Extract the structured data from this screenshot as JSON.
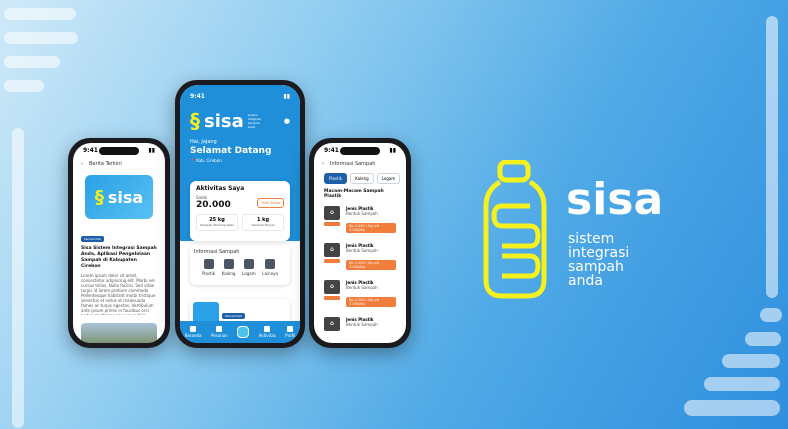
{
  "colors": {
    "brand_blue": "#1e8fd8",
    "accent_yellow": "#f4f11f",
    "accent_orange": "#f07d3a",
    "white": "#ffffff"
  },
  "brand": {
    "word": "sisa",
    "tagline": [
      "sistem",
      "integrasi",
      "sampah",
      "anda"
    ]
  },
  "left_phone": {
    "time": "9:41",
    "title": "Berita Terkini",
    "card_word": "sisa",
    "tag": "Pemerintah",
    "headline": "Sisa Sistem Integrasi Sampah Anda, Aplikasi Pengelolaan Sampah di Kabupaten Cirebon",
    "body": "Lorem ipsum dolor sit amet, consectetur adipiscing elit. Morbi vel cursus tellus. Nulla facilisi. Sed vitae turpis id lorem pretium commodo. Pellentesque habitant morbi tristique senectus et netus et malesuada fames ac turpis egestas. Vestibulum ante ipsum primis in faucibus orci luctus et ultrices posuere cubilia curae."
  },
  "middle_phone": {
    "time": "9:41",
    "logo_word": "sisa",
    "logo_small": [
      "sistem",
      "integrasi",
      "sampah",
      "anda"
    ],
    "greeting": "Hai, Jajang",
    "welcome": "Selamat Datang",
    "location": "Kab. Cirebon",
    "activity_title": "Aktivitas Saya",
    "saldo_label": "Saldo",
    "saldo_value": "20.000",
    "tarik_saldo": "Tarik Saldo",
    "stat1_value": "25 kg",
    "stat1_label": "Sampah Terkumpulkan",
    "stat2_value": "1 kg",
    "stat2_label": "Sampah Terjual",
    "info_title": "Informasi Sampah",
    "info_items": [
      "Plastik",
      "Kaleng",
      "Logam",
      "Lainnya"
    ],
    "news_title": "Berita Terbaru",
    "news_more": "Lihat Semua",
    "news_tag": "Pemerintah",
    "news_headline": "Sisa Sistem Integrasi Sampah Anda, Aplikasi Pengelolaan Sampah di Kabupaten Cirebon",
    "tabs": [
      "Beranda",
      "Pesanan",
      "",
      "Aktivitas",
      "Profil"
    ]
  },
  "right_phone": {
    "time": "9:41",
    "title": "Informasi Sampah",
    "chips": [
      "Plastik",
      "Kaleng",
      "Logam"
    ],
    "section_title": "Macam-Macam Sampah Plastik",
    "items": [
      {
        "code": "PETE",
        "type": "Jenis Plastik",
        "desc": "Bentuk Sampah",
        "price": "Rp 2.000 / Kg s/d 3.000/Kg"
      },
      {
        "code": "HDPE",
        "type": "Jenis Plastik",
        "desc": "Bentuk Sampah",
        "price": "Rp 2.000 / Kg s/d 3.000/Kg"
      },
      {
        "code": "PVC",
        "type": "Jenis Plastik",
        "desc": "Bentuk Sampah",
        "price": "Rp 2.000 / Kg s/d 3.000/Kg"
      },
      {
        "code": "LDPE",
        "type": "Jenis Plastik",
        "desc": "Bentuk Sampah",
        "price": "Rp 2.000 / Kg s/d 3.000/Kg"
      }
    ]
  }
}
